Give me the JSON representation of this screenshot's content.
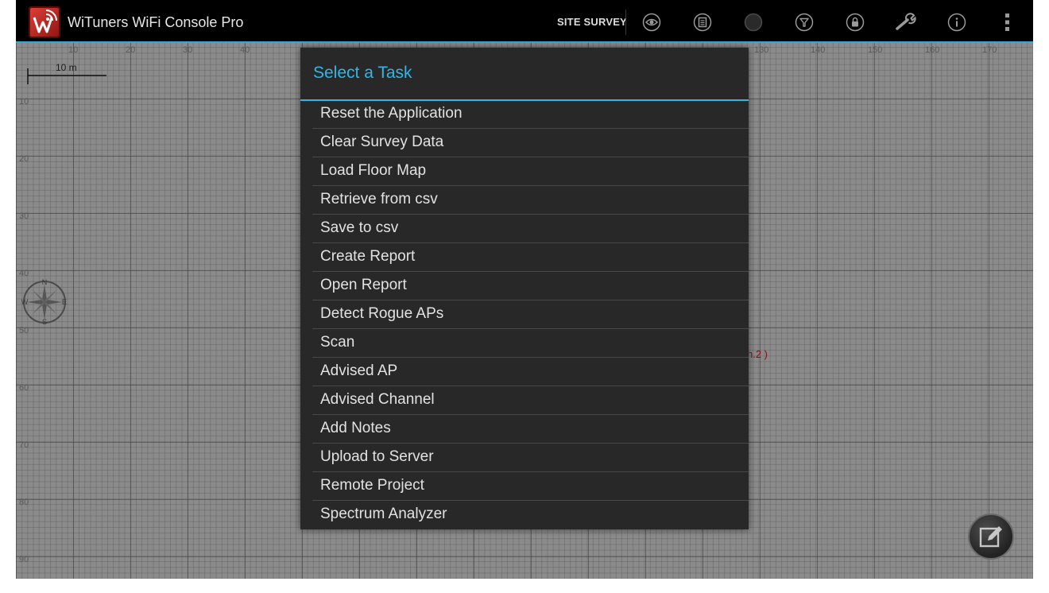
{
  "app": {
    "title": "WiTuners WiFi Console Pro",
    "mode_label": "SITE SURVEY",
    "accent_color": "#33b5e5",
    "logo_icon": "witunners-logo-icon"
  },
  "toolbar_icons": [
    "eye-icon",
    "list-icon",
    "circle-icon",
    "filter-icon",
    "lock-icon",
    "wrench-icon",
    "info-icon",
    "overflow-menu-icon"
  ],
  "map": {
    "scale_label": "10 m",
    "x_axis": [
      "10",
      "20",
      "30",
      "40",
      "130",
      "140",
      "150",
      "160",
      "170"
    ],
    "y_axis": [
      "10",
      "20",
      "30",
      "40",
      "50",
      "60",
      "70",
      "80",
      "90"
    ],
    "compass": {
      "n": "N",
      "s": "S",
      "e": "E",
      "w": "W"
    },
    "annotation": "h.2 )"
  },
  "dialog": {
    "title": "Select a Task",
    "tasks": [
      "Reset the Application",
      "Clear Survey Data",
      "Load Floor Map",
      "Retrieve from csv",
      "Save to csv",
      "Create Report",
      "Open Report",
      "Detect Rogue APs",
      "Scan",
      "Advised AP",
      "Advised Channel",
      "Add Notes",
      "Upload to Server",
      "Remote Project",
      "Spectrum Analyzer"
    ]
  },
  "fab_icon": "edit-icon"
}
